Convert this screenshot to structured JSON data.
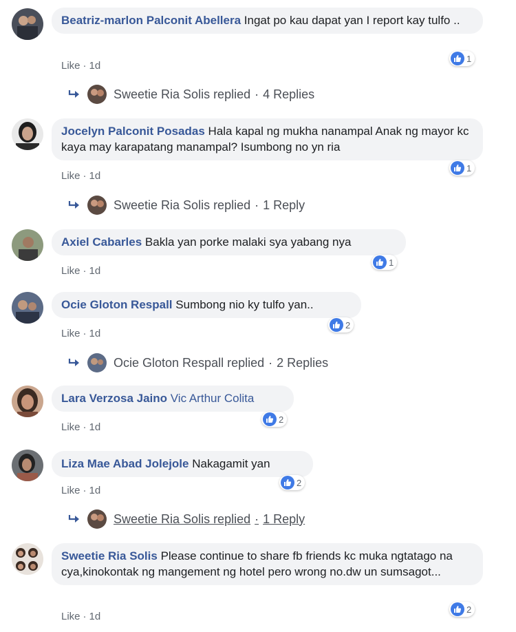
{
  "colors": {
    "author": "#385898",
    "bubble": "#f2f3f5",
    "meta": "#606770",
    "like_blue": "#3f7ae6"
  },
  "comments": [
    {
      "author": "Beatriz-marlon Palconit Abellera",
      "text": " Ingat po kau dapat yan I report kay tulfo ..",
      "reactions": "1",
      "like": "Like",
      "time": "1d",
      "reply": {
        "name": "Sweetie Ria Solis replied",
        "count": "4 Replies"
      }
    },
    {
      "author": "Jocelyn Palconit Posadas",
      "text": " Hala kapal ng mukha nanampal Anak ng mayor kc kaya may karapatang manampal? Isumbong no yn ria",
      "reactions": "1",
      "like": "Like",
      "time": "1d",
      "reply": {
        "name": "Sweetie Ria Solis replied",
        "count": "1 Reply"
      }
    },
    {
      "author": "Axiel Cabarles",
      "text": " Bakla yan porke malaki sya yabang nya",
      "reactions": "1",
      "like": "Like",
      "time": "1d"
    },
    {
      "author": "Ocie Gloton Respall",
      "text": " Sumbong nio ky tulfo yan..",
      "reactions": "2",
      "like": "Like",
      "time": "1d",
      "reply": {
        "name": "Ocie Gloton Respall replied",
        "count": "2 Replies"
      }
    },
    {
      "author": "Lara Verzosa Jaino",
      "mention": " Vic Arthur Colita",
      "reactions": "2",
      "like": "Like",
      "time": "1d"
    },
    {
      "author": "Liza Mae Abad Jolejole",
      "text": " Nakagamit yan",
      "reactions": "2",
      "like": "Like",
      "time": "1d",
      "reply": {
        "name": "Sweetie Ria Solis replied",
        "count": "1 Reply"
      }
    },
    {
      "author": "Sweetie Ria Solis",
      "text": " Please continue to share fb friends kc muka ngtatago na cya,kinokontak ng mangement ng hotel pero wrong no.dw un sumsagot...",
      "reactions": "2",
      "like": "Like",
      "time": "1d"
    }
  ]
}
